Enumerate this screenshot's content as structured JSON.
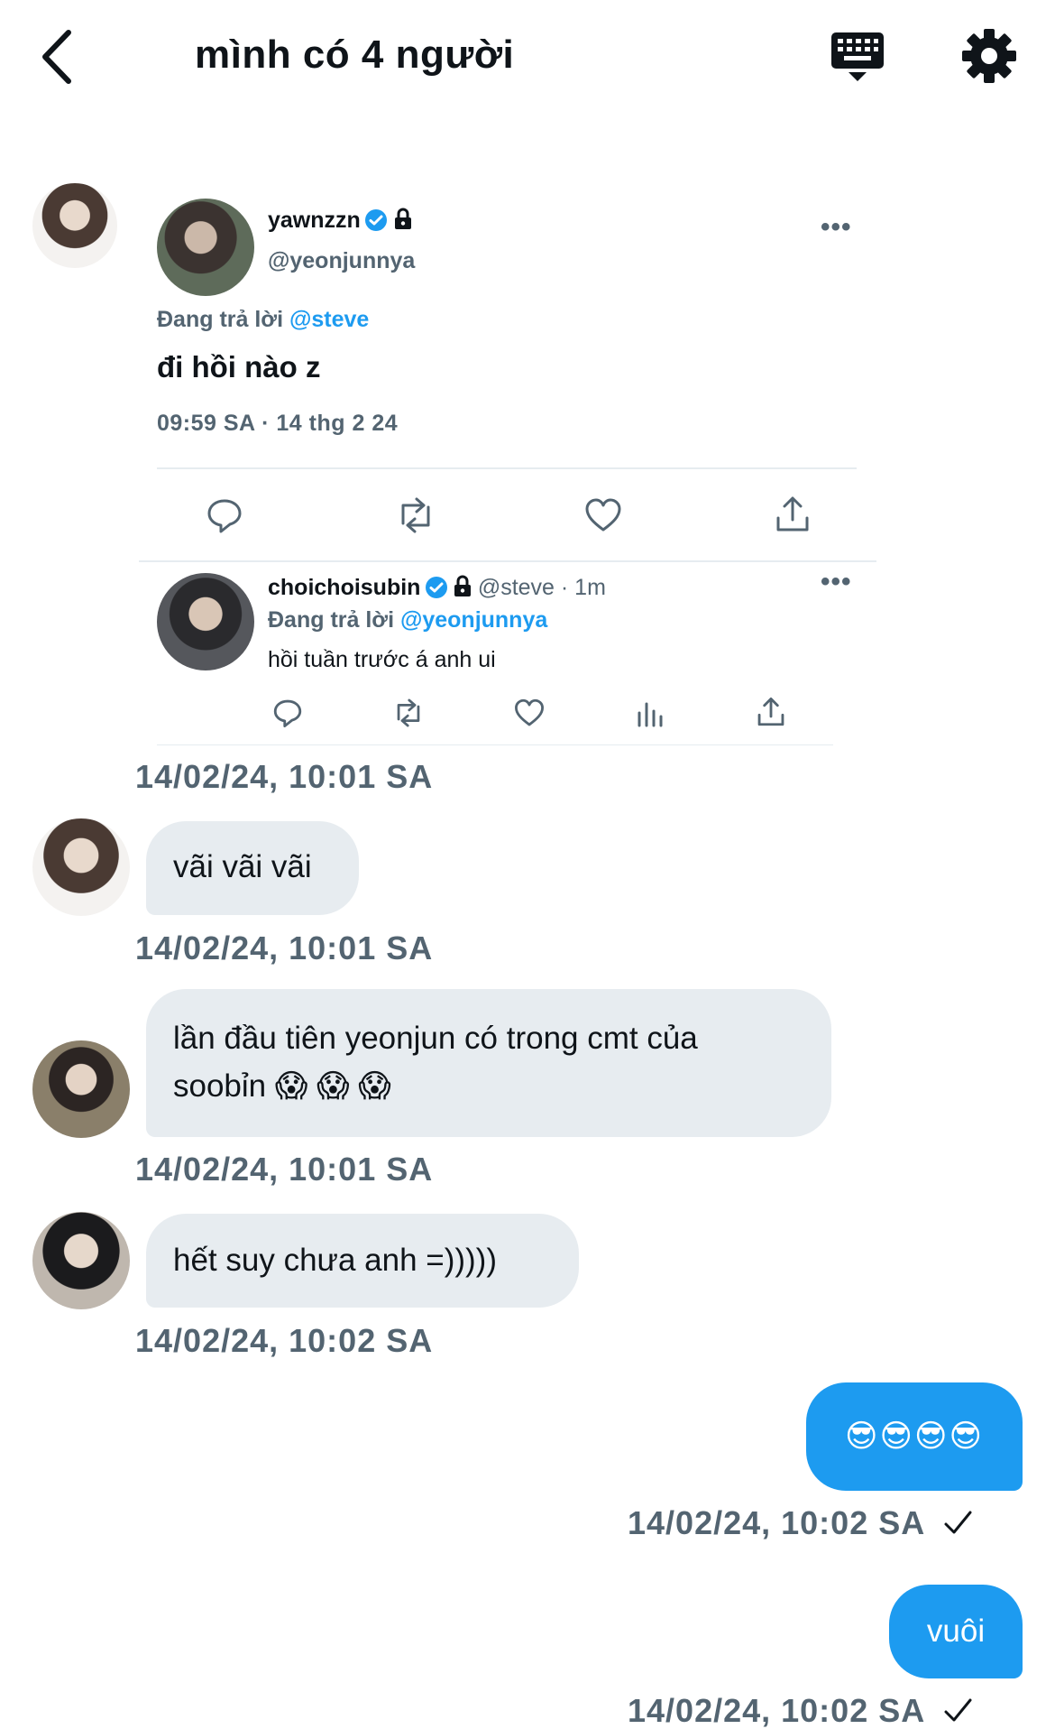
{
  "header": {
    "title": "mình có 4 người",
    "back_icon": "chevron-left-icon",
    "keyboard_icon": "keyboard-icon",
    "settings_icon": "gear-icon"
  },
  "shared_tweet": {
    "author_name": "yawnzzn",
    "author_handle": "@yeonjunnya",
    "replying_label": "Đang trả lời",
    "replying_to": "@steve",
    "text": "đi hồi nào z",
    "timestamp": "09:59 SA · 14 thg 2 24",
    "reply": {
      "author_name": "choichoisubin",
      "meta": "@steve · 1m",
      "replying_label": "Đang trả lời",
      "replying_to": "@yeonjunnya",
      "text": "hồi tuần trước á anh ui"
    }
  },
  "messages": [
    {
      "timestamp": "14/02/24, 10:01 SA"
    },
    {
      "text": "vãi vãi vãi",
      "timestamp": "14/02/24, 10:01 SA"
    },
    {
      "text_line1": "lần đầu tiên yeonjun có trong cmt của",
      "text_line2": "soobỉn 😱 😱 😱",
      "timestamp": "14/02/24, 10:01 SA"
    },
    {
      "text": "hết suy chưa anh =)))))",
      "timestamp": "14/02/24, 10:02 SA"
    },
    {
      "text": "😎😎😎😎",
      "timestamp": "14/02/24, 10:02 SA"
    },
    {
      "text": "vuôi",
      "timestamp": "14/02/24, 10:02 SA"
    }
  ],
  "colors": {
    "accent": "#1d9bf0",
    "bubble_in": "#e7ecf0",
    "muted": "#536471"
  }
}
